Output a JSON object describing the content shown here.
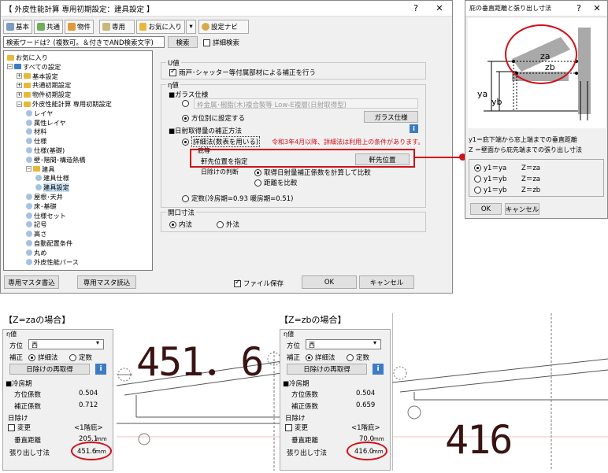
{
  "main_window": {
    "title": "【 外皮性能計算 専用初期設定：建具設定 】",
    "help": "?",
    "close": "✕",
    "toolbar": {
      "basic": "基本",
      "common": "共通",
      "property": "物件",
      "dedicated": "専用",
      "favorites": "お気に入り",
      "setting_navi": "設定ナビ"
    },
    "search": {
      "value": "検索ワードは？(複数可。＆付きでAND検索文字)",
      "button": "検索",
      "detail": "詳細検索"
    },
    "tree": [
      {
        "label": "お気に入り",
        "level": 0,
        "kind": "fav"
      },
      {
        "label": "すべての設定",
        "level": 0,
        "kind": "root",
        "exp": "⊟"
      },
      {
        "label": "基本設定",
        "level": 1,
        "kind": "folder",
        "exp": "⊞"
      },
      {
        "label": "共通初期設定",
        "level": 1,
        "kind": "folder",
        "exp": "⊞"
      },
      {
        "label": "物件初期設定",
        "level": 1,
        "kind": "folder",
        "exp": "⊞"
      },
      {
        "label": "外皮性能計算 専用初期設定",
        "level": 1,
        "kind": "folder",
        "exp": "⊟"
      },
      {
        "label": "レイヤ",
        "level": 2,
        "kind": "doc"
      },
      {
        "label": "属性レイヤ",
        "level": 2,
        "kind": "doc"
      },
      {
        "label": "材料",
        "level": 2,
        "kind": "doc"
      },
      {
        "label": "仕様",
        "level": 2,
        "kind": "doc"
      },
      {
        "label": "仕様(基礎)",
        "level": 2,
        "kind": "doc"
      },
      {
        "label": "壁･階間･構造熱橋",
        "level": 2,
        "kind": "doc"
      },
      {
        "label": "建具",
        "level": 2,
        "kind": "folder",
        "exp": "⊟"
      },
      {
        "label": "建具仕様",
        "level": 3,
        "kind": "doc"
      },
      {
        "label": "建具設定",
        "level": 3,
        "kind": "doc",
        "selected": true
      },
      {
        "label": "屋根･天井",
        "level": 2,
        "kind": "doc"
      },
      {
        "label": "床･基礎",
        "level": 2,
        "kind": "doc"
      },
      {
        "label": "仕様セット",
        "level": 2,
        "kind": "doc"
      },
      {
        "label": "記号",
        "level": 2,
        "kind": "doc"
      },
      {
        "label": "高さ",
        "level": 2,
        "kind": "doc"
      },
      {
        "label": "自動配置条件",
        "level": 2,
        "kind": "doc"
      },
      {
        "label": "丸め",
        "level": 2,
        "kind": "doc"
      },
      {
        "label": "外皮性能パース",
        "level": 2,
        "kind": "doc"
      }
    ],
    "u_value": {
      "group": "U値",
      "shutter": "雨戸･シャッター等付属部材による補正を行う"
    },
    "eta_value": {
      "group": "η値",
      "glass_spec": "■ガラス仕様",
      "glass_opt1": "枠金属･樹脂(木)複合製等 Low-E複層(日射取得型)",
      "glass_opt2": "方位別に設定する",
      "glass_button": "ガラス仕様",
      "correction": "■日射取得量の補正方法",
      "detail_method": "詳細法(数表を用いる)",
      "warning": "令和3年4月以降、詳細法は利用上の条件があります。",
      "eaves_label": "庇等",
      "eaves_specify": "軒先位置を指定",
      "eaves_button": "軒先位置",
      "shading_judge": "日除けの判断",
      "opt_calc": "取得日射量補正係数を計算して比較",
      "opt_dist": "距離を比較",
      "fixed": "定数(冷房期=0.93 暖房期=0.51)"
    },
    "opening": {
      "group": "開口寸法",
      "inner": "内法",
      "outer": "外法"
    },
    "footer": {
      "master_write": "専用マスタ書込",
      "master_read": "専用マスタ読込",
      "save_file": "ファイル保存",
      "ok": "OK",
      "cancel": "キャンセル"
    }
  },
  "eaves_dialog": {
    "title": "庇の垂直距離と張り出し寸法",
    "help": "?",
    "close": "✕",
    "diagram_labels": {
      "za": "za",
      "zb": "zb",
      "ya": "ya",
      "yb": "yb"
    },
    "desc1": "y1＝庇下端から窓上端までの垂直距離",
    "desc2": "Z ＝壁面から庇先端までの張り出し寸法",
    "options": [
      {
        "y": "y1＝ya",
        "z": "Z＝za",
        "selected": true
      },
      {
        "y": "y1＝yb",
        "z": "Z＝za",
        "selected": false
      },
      {
        "y": "y1＝yb",
        "z": "Z＝zb",
        "selected": false
      }
    ],
    "ok": "OK",
    "cancel": "キャンセル"
  },
  "case_za": {
    "caption": "【Z=zaの場合】",
    "group": "η値",
    "direction_label": "方位",
    "direction_value": "西",
    "correction_label": "補正",
    "detail": "詳細法",
    "fixed": "定数",
    "reacquire": "日除けの再取得",
    "cooling": "■冷房期",
    "dir_coef_label": "方位係数",
    "dir_coef": "0.504",
    "corr_coef_label": "補正係数",
    "corr_coef": "0.712",
    "shade_group": "日除け",
    "change": "変更",
    "floor": "<1階庇>",
    "vert_label": "垂直距離",
    "vert_value": "205.1",
    "over_label": "張り出し寸法",
    "over_value": "451.6",
    "unit": "mm",
    "big": "451．6"
  },
  "case_zb": {
    "caption": "【Z=zbの場合】",
    "group": "η値",
    "direction_label": "方位",
    "direction_value": "西",
    "correction_label": "補正",
    "detail": "詳細法",
    "fixed": "定数",
    "reacquire": "日除けの再取得",
    "cooling": "■冷房期",
    "dir_coef_label": "方位係数",
    "dir_coef": "0.504",
    "corr_coef_label": "補正係数",
    "corr_coef": "0.659",
    "shade_group": "日除け",
    "change": "変更",
    "floor": "<1階庇>",
    "vert_label": "垂直距離",
    "vert_value": "70.0",
    "over_label": "張り出し寸法",
    "over_value": "416.0",
    "unit": "mm",
    "big": "416"
  },
  "colors": {
    "accent_red": "#d0101a",
    "big_number": "#3a1313"
  }
}
